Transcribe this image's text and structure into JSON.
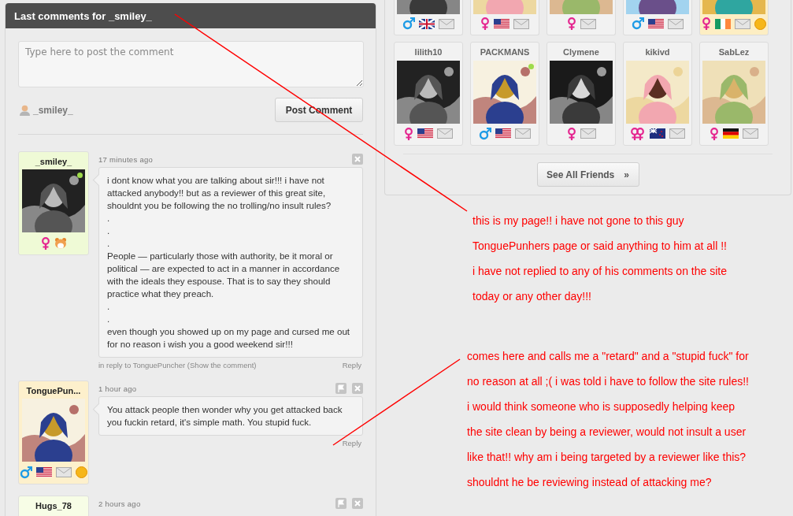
{
  "comments_panel": {
    "title": "Last comments for _smiley_",
    "placeholder": "Type here to post the comment",
    "current_user": "_smiley_",
    "post_button": "Post Comment",
    "comments": [
      {
        "author": "_smiley_",
        "time": "17 minutes ago",
        "can_flag": false,
        "color": "#effad6",
        "online": true,
        "icons": [
          {
            "kind": "female"
          },
          {
            "kind": "hamster"
          }
        ],
        "lines": [
          "i dont know what you are talking about sir!!! i have not attacked anybody!! but as a reviewer of this great site, shouldnt you be following the no trolling/no insult rules?",
          ".",
          ".",
          ".",
          "People — particularly those with authority, be it moral or political — are expected to act in a manner in accordance with the ideals they espouse. That is to say they should practice what they preach.",
          ".",
          ".",
          "even though you showed up on my page and cursed me out for no reason i wish you a good weekend sir!!!"
        ],
        "reply_to": {
          "text": "in reply to TonguePuncher",
          "link": "(Show the comment)"
        },
        "reply": "Reply"
      },
      {
        "author": "TonguePun...",
        "time": "1 hour ago",
        "can_flag": true,
        "color": "#fdf0cc",
        "online": false,
        "icons": [
          {
            "kind": "male"
          },
          {
            "kind": "flag_us"
          },
          {
            "kind": "mail"
          },
          {
            "kind": "vip"
          }
        ],
        "lines": [
          "You attack people then wonder why you get attacked back you fuckin retard, it's simple math. You stupid fuck."
        ],
        "reply": "Reply"
      },
      {
        "author": "Hugs_78",
        "time": "2 hours ago",
        "can_flag": true,
        "color": "#f7fde6"
      }
    ]
  },
  "friends_panel": {
    "rows": [
      [
        {
          "vip": false,
          "online": false,
          "icons": [
            {
              "kind": "male"
            },
            {
              "kind": "flag_uk"
            },
            {
              "kind": "mail"
            }
          ]
        },
        {
          "vip": false,
          "online": false,
          "icons": [
            {
              "kind": "female"
            },
            {
              "kind": "flag_us"
            },
            {
              "kind": "mail"
            }
          ]
        },
        {
          "vip": false,
          "online": false,
          "icons": [
            {
              "kind": "female"
            },
            {
              "kind": "mail"
            }
          ]
        },
        {
          "vip": false,
          "online": false,
          "icons": [
            {
              "kind": "male"
            },
            {
              "kind": "flag_us"
            },
            {
              "kind": "mail"
            }
          ]
        },
        {
          "vip": true,
          "online": false,
          "icons": [
            {
              "kind": "female"
            },
            {
              "kind": "flag_ie"
            },
            {
              "kind": "mail"
            },
            {
              "kind": "vip"
            }
          ]
        }
      ],
      [
        {
          "name": "lilith10",
          "vip": false,
          "online": false,
          "icons": [
            {
              "kind": "female"
            },
            {
              "kind": "flag_us"
            },
            {
              "kind": "mail"
            }
          ]
        },
        {
          "name": "PACKMANS",
          "vip": false,
          "online": true,
          "icons": [
            {
              "kind": "male"
            },
            {
              "kind": "flag_us"
            },
            {
              "kind": "mail"
            }
          ]
        },
        {
          "name": "Clymene",
          "vip": false,
          "online": false,
          "icons": [
            {
              "kind": "female"
            },
            {
              "kind": "mail"
            }
          ]
        },
        {
          "name": "kikivd",
          "vip": false,
          "online": false,
          "icons": [
            {
              "kind": "couple"
            },
            {
              "kind": "flag_nz"
            },
            {
              "kind": "mail"
            }
          ]
        },
        {
          "name": "SabLez",
          "vip": false,
          "online": false,
          "icons": [
            {
              "kind": "female"
            },
            {
              "kind": "flag_de"
            },
            {
              "kind": "mail"
            }
          ]
        }
      ]
    ],
    "see_all": "See All Friends",
    "see_all_icon": "»"
  },
  "annotations": [
    {
      "lines": [
        "this is my page!! i have not gone to this guy",
        "TonguePunhers  page or said anything to him at all !!",
        "i have not replied to any of his comments on the site",
        "today or any other day!!!"
      ]
    },
    {
      "lines": [
        "comes here and calls me a \"retard\" and a \"stupid fuck\" for",
        "no reason at all ;(  i was told i have to follow the site rules!!",
        "i would think someone who is supposedly helping keep",
        "the site clean by being a reviewer, would not insult a user",
        "like that!! why am i being targeted by a reviewer like this?",
        "shouldnt he be reviewing instead of attacking me?"
      ]
    }
  ]
}
